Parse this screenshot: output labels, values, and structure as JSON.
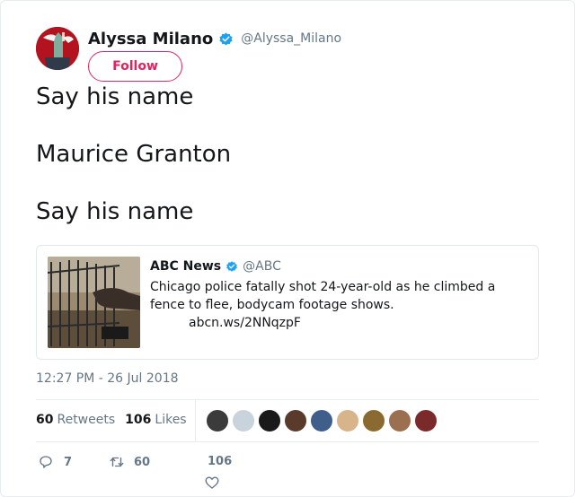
{
  "author": {
    "display_name": "Alyssa Milano",
    "handle": "@Alyssa_Milano",
    "avatar_icon": "avatar-image",
    "verified_icon": "verified-badge-icon",
    "follow_label": "Follow"
  },
  "tweet": {
    "lines": [
      "Say his name",
      "Maurice Granton",
      "Say his name"
    ]
  },
  "quoted": {
    "name": "ABC News",
    "handle": "@ABC",
    "text": "Chicago police fatally shot 24-year-old as he climbed a fence to flee, bodycam footage shows.",
    "link": "abcn.ws/2NNqzpF",
    "thumbnail_icon": "bodycam-thumbnail-image"
  },
  "timestamp": "12:27 PM - 26 Jul 2018",
  "stats": {
    "retweets_count": "60",
    "retweets_label": "Retweets",
    "likes_count": "106",
    "likes_label": "Likes"
  },
  "likers": {
    "count_shown": 9,
    "colors": [
      "#3b3b3b",
      "#c9d3dc",
      "#1a1a1a",
      "#5a3a2a",
      "#3f5f8a",
      "#d8b48a",
      "#8a6a30",
      "#9a7050",
      "#7a2a2a"
    ]
  },
  "actions": {
    "reply_count": "7",
    "retweet_count": "60",
    "like_count": "106",
    "reply_icon": "reply-icon",
    "retweet_icon": "retweet-icon",
    "like_icon": "heart-icon"
  },
  "colors": {
    "accent_pink": "#e0245e",
    "verified_blue": "#1da1f2",
    "muted_text": "#657786"
  }
}
